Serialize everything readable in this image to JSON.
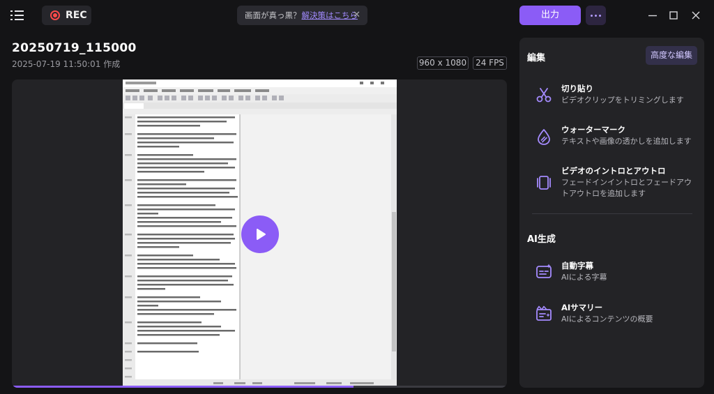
{
  "topbar": {
    "rec_label": "REC",
    "notice_text": "画面が真っ黒？",
    "notice_link": "解決策はこちら",
    "export_label": "出力"
  },
  "recording": {
    "title": "20250719_115000",
    "created": "2025-07-19 11:50:01 作成",
    "resolution": "960 x 1080",
    "fps": "24 FPS"
  },
  "player": {
    "progress": 0.69
  },
  "panel": {
    "edit_heading": "編集",
    "advanced_label": "高度な編集",
    "edit_features": [
      {
        "title": "切り貼り",
        "desc": "ビデオクリップをトリミングします",
        "icon": "scissors-icon"
      },
      {
        "title": "ウォーターマーク",
        "desc": "テキストや画像の透かしを追加します",
        "icon": "watermark-icon"
      },
      {
        "title": "ビデオのイントロとアウトロ",
        "desc": "フェードインイントロとフェードアウトアウトロを追加します",
        "icon": "intro-outro-icon"
      }
    ],
    "ai_heading": "AI生成",
    "ai_features": [
      {
        "title": "自動字幕",
        "desc": "AIによる字幕",
        "icon": "subtitle-icon"
      },
      {
        "title": "AIサマリー",
        "desc": "AIによるコンテンツの概要",
        "icon": "ai-summary-icon"
      }
    ]
  },
  "colors": {
    "accent": "#8b5cf6",
    "background": "#141416",
    "panel": "#232326"
  }
}
